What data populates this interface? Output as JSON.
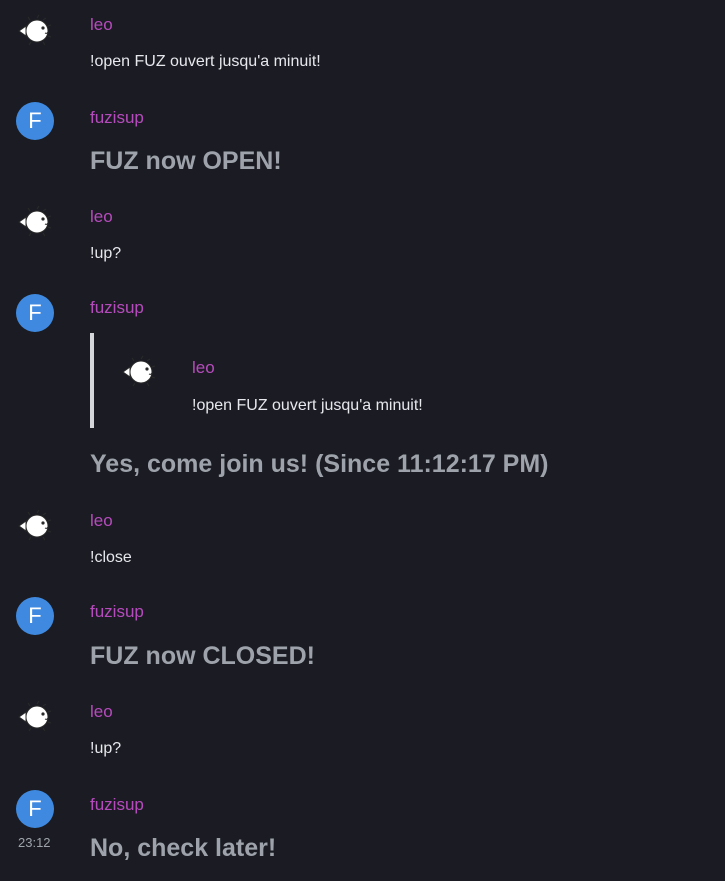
{
  "avatar_letter": "F",
  "messages": [
    {
      "sender": "leo",
      "body": "!open FUZ ouvert jusqu'a minuit!"
    },
    {
      "sender": "fuzisup",
      "body": "FUZ now OPEN!"
    },
    {
      "sender": "leo",
      "body": "!up?"
    },
    {
      "sender": "fuzisup",
      "quote": {
        "sender": "leo",
        "body": "!open FUZ ouvert jusqu'a minuit!"
      },
      "body": "Yes, come join us! (Since 11:12:17 PM)"
    },
    {
      "sender": "leo",
      "body": "!close"
    },
    {
      "sender": "fuzisup",
      "body": "FUZ now CLOSED!"
    },
    {
      "sender": "leo",
      "body": "!up?"
    },
    {
      "sender": "fuzisup",
      "body": "No, check later!",
      "timestamp": "23:12"
    }
  ],
  "colors": {
    "background": "#1b1c23",
    "sender_name": "#b64bbd",
    "avatar_bg": "#3f8ae0",
    "bot_text": "#9ea3ab",
    "user_text": "#e6e8ee",
    "quote_border": "#d4d6da"
  },
  "icons": {
    "leo_avatar": "pufferfish-avatar-icon",
    "fuzisup_avatar": "letter-avatar"
  }
}
